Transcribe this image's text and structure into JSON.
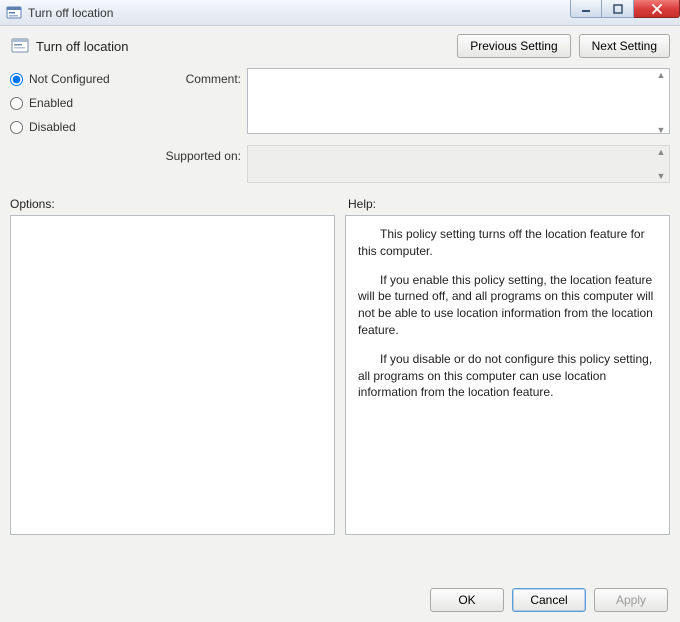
{
  "window": {
    "title": "Turn off location"
  },
  "header": {
    "policy_title": "Turn off location",
    "prev_label": "Previous Setting",
    "next_label": "Next Setting"
  },
  "state": {
    "not_configured_label": "Not Configured",
    "enabled_label": "Enabled",
    "disabled_label": "Disabled",
    "selected": "not_configured"
  },
  "fields": {
    "comment_label": "Comment:",
    "comment_value": "",
    "supported_label": "Supported on:",
    "supported_value": ""
  },
  "sections": {
    "options_label": "Options:",
    "help_label": "Help:"
  },
  "help": {
    "p1": "This policy setting turns off the location feature for this computer.",
    "p2": "If you enable this policy setting, the location feature will be turned off, and all programs on this computer will not be able to use location information from the location feature.",
    "p3": "If you disable or do not configure this policy setting, all programs on this computer can use location information from the location feature."
  },
  "footer": {
    "ok_label": "OK",
    "cancel_label": "Cancel",
    "apply_label": "Apply"
  }
}
